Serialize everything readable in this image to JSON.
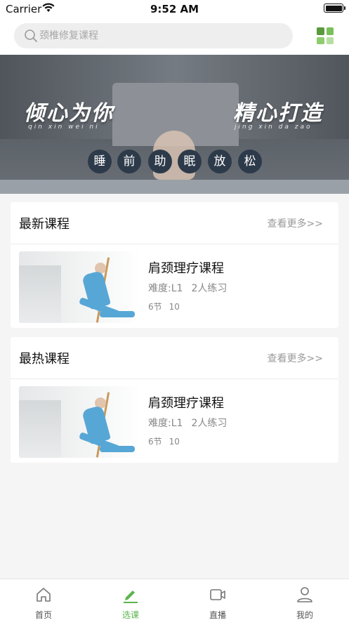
{
  "status_bar": {
    "carrier": "Carrier",
    "time": "9:52 AM"
  },
  "search": {
    "placeholder": "颈椎修复课程",
    "icon": "search-icon"
  },
  "grid_button": {
    "icon": "grid-icon",
    "colors": [
      "#5a9a3c",
      "#7bbf5a",
      "#8fcc6e",
      "#b8dfa2"
    ]
  },
  "banner": {
    "title_left": "倾心为你",
    "subtitle_left": "qin xin wei ni",
    "title_right": "精心打造",
    "subtitle_right": "jing xin da zao",
    "pills": [
      "睡",
      "前",
      "助",
      "眠",
      "放",
      "松"
    ]
  },
  "sections": [
    {
      "title": "最新课程",
      "more": "查看更多>>",
      "course": {
        "name": "肩颈理疗课程",
        "difficulty": "难度:L1",
        "practice": "2人练习",
        "lessons": "6节",
        "count": "10"
      }
    },
    {
      "title": "最热课程",
      "more": "查看更多>>",
      "course": {
        "name": "肩颈理疗课程",
        "difficulty": "难度:L1",
        "practice": "2人练习",
        "lessons": "6节",
        "count": "10"
      }
    }
  ],
  "tabbar": {
    "active_color": "#5bb54c",
    "items": [
      {
        "label": "首页",
        "icon": "home-icon"
      },
      {
        "label": "选课",
        "icon": "pencil-icon"
      },
      {
        "label": "直播",
        "icon": "video-icon"
      },
      {
        "label": "我的",
        "icon": "user-icon"
      }
    ]
  }
}
